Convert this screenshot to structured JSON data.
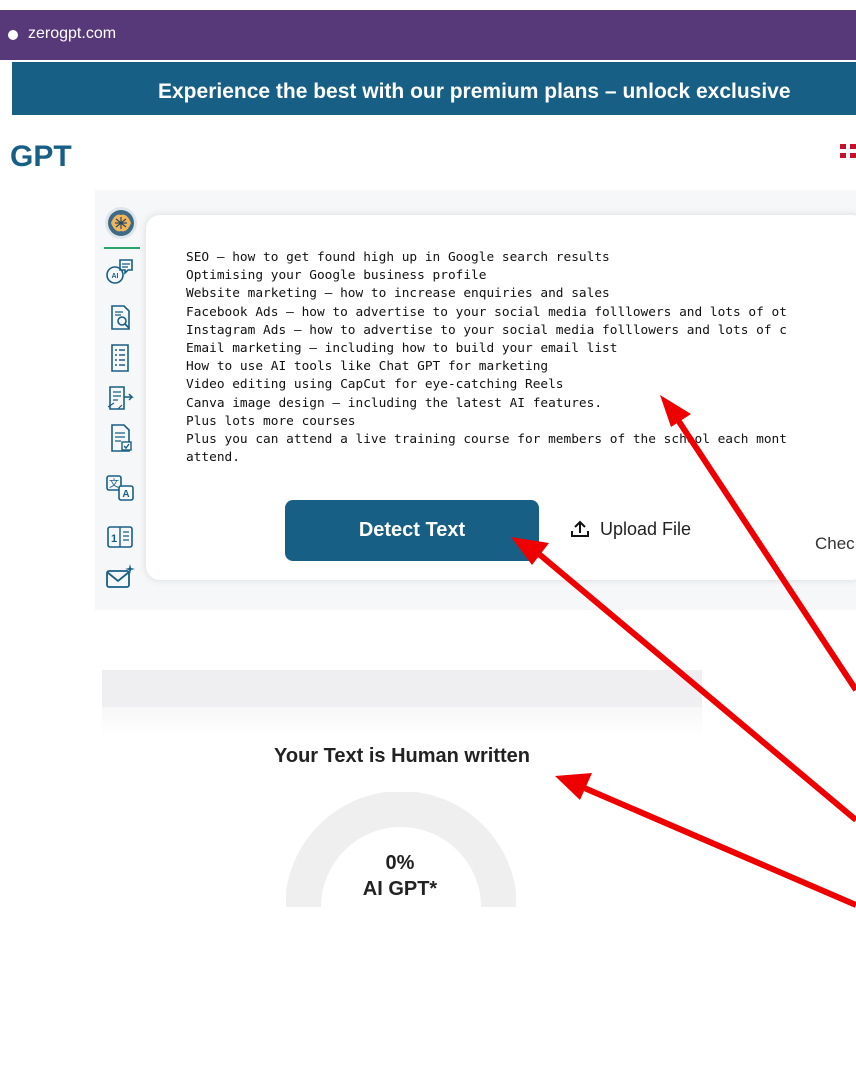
{
  "browser": {
    "tab_url": "zerogpt.com"
  },
  "promo_banner": {
    "text": "Experience the best with our premium plans – unlock exclusive"
  },
  "header": {
    "brand": "GPT",
    "language_flag_icon": "uk-flag-icon"
  },
  "sidebar": {
    "icons": [
      "brain-logo-icon",
      "ai-chat-icon",
      "document-search-icon",
      "document-list-icon",
      "document-export-icon",
      "document-check-icon",
      "translate-icon",
      "word-counter-icon",
      "email-sparkle-icon"
    ]
  },
  "editor": {
    "lines": [
      "SEO – how to get found high up in Google search results",
      "Optimising your Google business profile",
      "Website marketing – how to increase enquiries and sales",
      "Facebook Ads – how to advertise to your social media folllowers and lots of ot",
      "Instagram Ads – how to advertise to your social media folllowers and lots of c",
      "Email marketing – including how to build your email list",
      "How to use AI tools like Chat GPT for marketing",
      "Video editing using CapCut for eye-catching Reels",
      "Canva image design – including the latest AI features.",
      "Plus lots more courses",
      "Plus you can attend a live training course for members of the school each mont",
      "attend."
    ]
  },
  "actions": {
    "detect_label": "Detect Text",
    "upload_label": "Upload File",
    "upload_icon": "upload-icon",
    "check_label": "Chec"
  },
  "result": {
    "title": "Your Text is Human written",
    "percentage": "0%",
    "percentage_value": 0,
    "ai_label": "AI GPT*"
  },
  "colors": {
    "tab_bar": "#57397a",
    "brand_blue": "#185f86",
    "annotation_red": "#ee0000"
  }
}
